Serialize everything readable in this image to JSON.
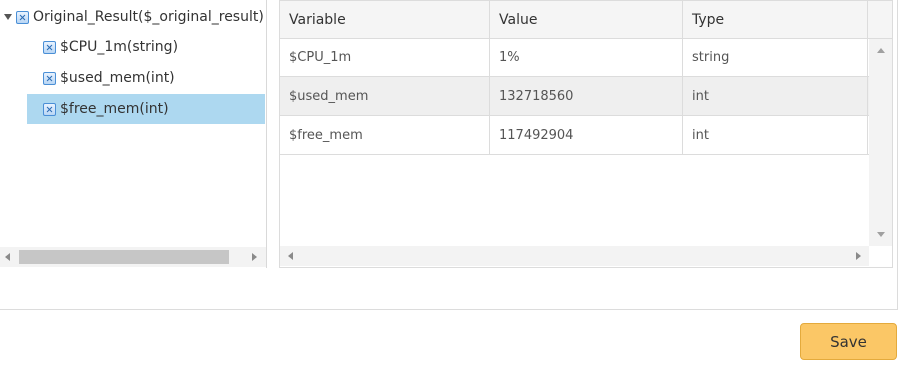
{
  "tree": {
    "root": {
      "label": "Original_Result($_original_result)"
    },
    "children": [
      {
        "label": "$CPU_1m(string)"
      },
      {
        "label": "$used_mem(int)"
      },
      {
        "label": "$free_mem(int)",
        "selected": true
      }
    ]
  },
  "grid": {
    "columns": [
      "Variable",
      "Value",
      "Type"
    ],
    "rows": [
      [
        "$CPU_1m",
        "1%",
        "string"
      ],
      [
        "$used_mem",
        "132718560",
        "int"
      ],
      [
        "$free_mem",
        "117492904",
        "int"
      ]
    ]
  },
  "footer": {
    "save_label": "Save"
  },
  "colors": {
    "selected_row": "#add8f0",
    "save_button": "#fbc766",
    "alt_row": "#efefef"
  }
}
